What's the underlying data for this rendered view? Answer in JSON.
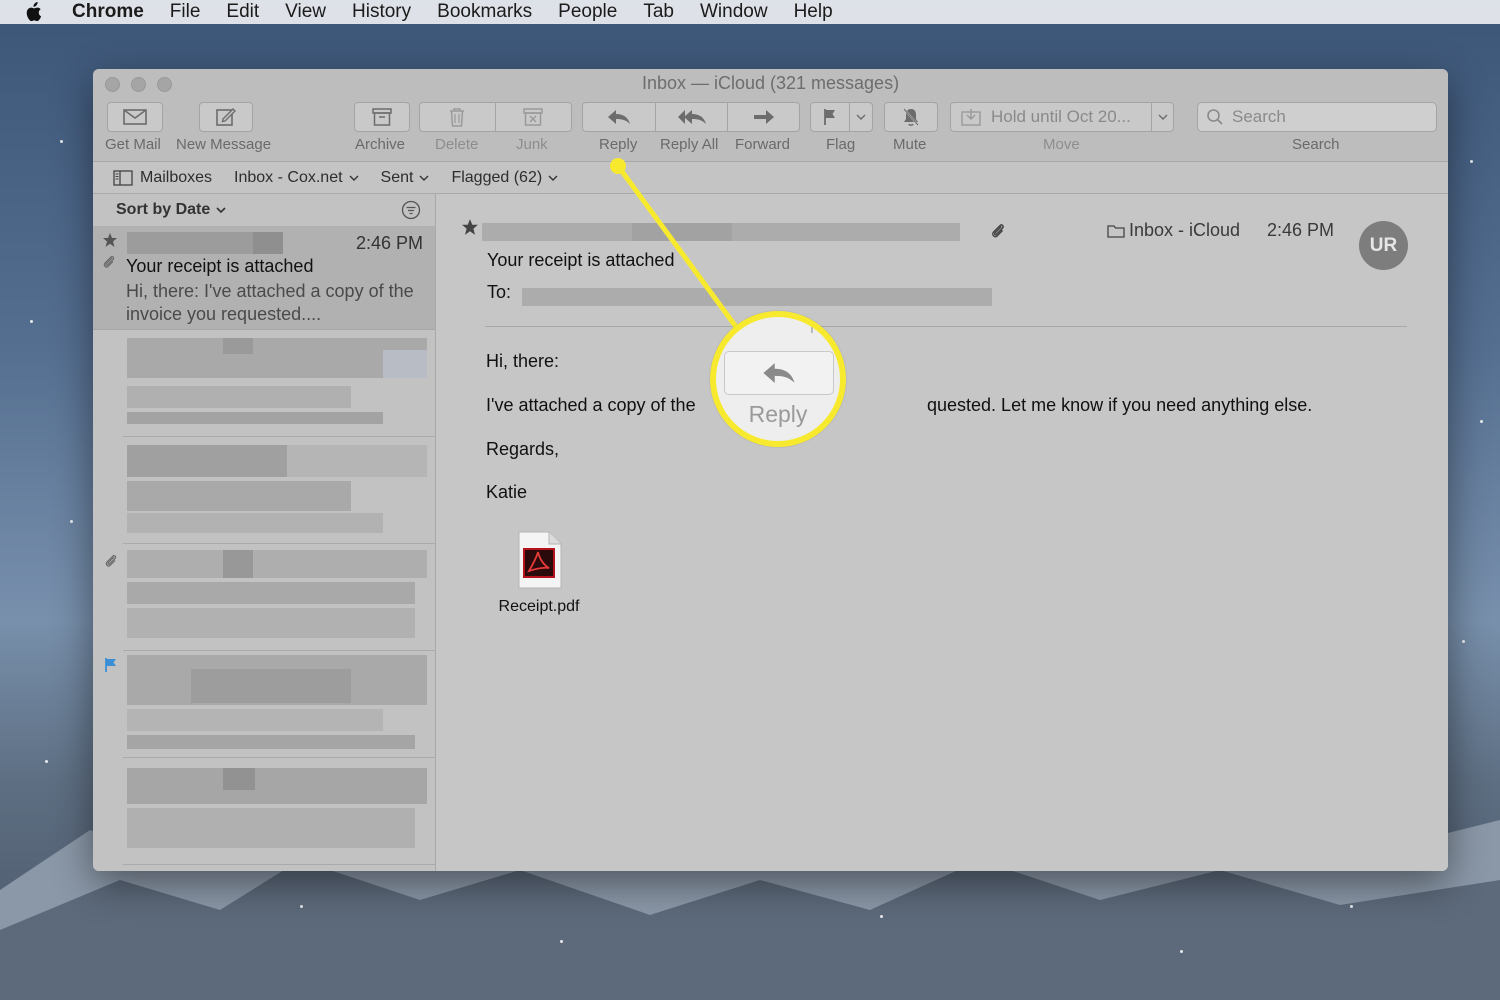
{
  "menubar": {
    "app": "Chrome",
    "items": [
      "File",
      "Edit",
      "View",
      "History",
      "Bookmarks",
      "People",
      "Tab",
      "Window",
      "Help"
    ]
  },
  "window": {
    "title": "Inbox — iCloud (321 messages)"
  },
  "toolbar": {
    "get_mail": "Get Mail",
    "new_message": "New Message",
    "archive": "Archive",
    "delete": "Delete",
    "junk": "Junk",
    "reply": "Reply",
    "reply_all": "Reply All",
    "forward": "Forward",
    "flag": "Flag",
    "mute": "Mute",
    "move_value": "Hold until Oct 20...",
    "move": "Move",
    "search_placeholder": "Search",
    "search": "Search"
  },
  "favorites": {
    "mailboxes": "Mailboxes",
    "inbox": "Inbox - Cox.net",
    "sent": "Sent",
    "flagged": "Flagged (62)"
  },
  "message_list": {
    "sort": "Sort by Date",
    "selected": {
      "time": "2:46 PM",
      "subject": "Your receipt is attached",
      "preview": "Hi, there: I've attached a copy of the invoice you requested...."
    }
  },
  "reader": {
    "mailbox": "Inbox - iCloud",
    "time": "2:46 PM",
    "avatar": "UR",
    "subject": "Your receipt is attached",
    "to_label": "To:",
    "greeting": "Hi, there:",
    "body_start": "I've attached a copy of the",
    "body_end": "quested. Let me know if you need anything else.",
    "closing": "Regards,",
    "signature": "Katie",
    "attachment": "Receipt.pdf"
  },
  "callout": {
    "label": "Reply"
  },
  "colors": {
    "callout": "#f7ea2e",
    "flag": "#3a8fd6",
    "pdf_red": "#b5121b"
  }
}
